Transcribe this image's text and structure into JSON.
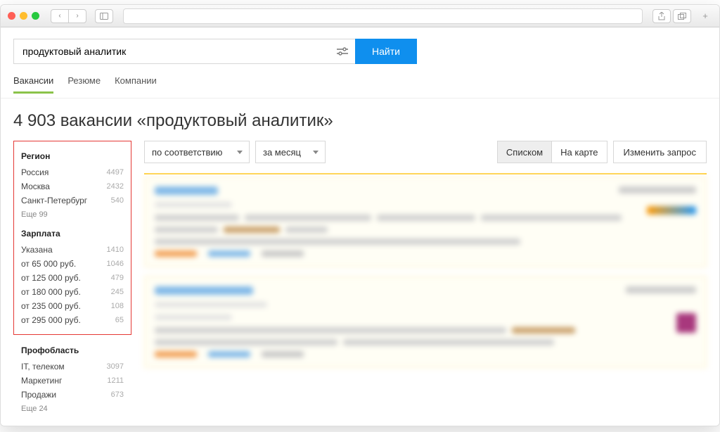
{
  "search": {
    "value": "продуктовый аналитик",
    "button": "Найти"
  },
  "tabs": [
    {
      "label": "Вакансии",
      "active": true
    },
    {
      "label": "Резюме",
      "active": false
    },
    {
      "label": "Компании",
      "active": false
    }
  ],
  "heading": "4 903 вакансии «продуктовый аналитик»",
  "sidebar": {
    "blocks": [
      {
        "title": "Регион",
        "highlighted": true,
        "items": [
          {
            "label": "Россия",
            "count": "4497"
          },
          {
            "label": "Москва",
            "count": "2432"
          },
          {
            "label": "Санкт-Петербург",
            "count": "540"
          }
        ],
        "more": "Еще 99"
      },
      {
        "title": "Зарплата",
        "highlighted": true,
        "items": [
          {
            "label": "Указана",
            "count": "1410"
          },
          {
            "label": "от 65 000 руб.",
            "count": "1046"
          },
          {
            "label": "от 125 000 руб.",
            "count": "479"
          },
          {
            "label": "от 180 000 руб.",
            "count": "245"
          },
          {
            "label": "от 235 000 руб.",
            "count": "108"
          },
          {
            "label": "от 295 000 руб.",
            "count": "65"
          }
        ]
      },
      {
        "title": "Профобласть",
        "highlighted": false,
        "items": [
          {
            "label": "IT, телеком",
            "count": "3097"
          },
          {
            "label": "Маркетинг",
            "count": "1211"
          },
          {
            "label": "Продажи",
            "count": "673"
          }
        ],
        "more": "Еще 24"
      }
    ]
  },
  "controls": {
    "sort": "по соответствию",
    "period": "за месяц",
    "view": {
      "list": "Списком",
      "map": "На карте"
    },
    "changeQuery": "Изменить запрос"
  }
}
